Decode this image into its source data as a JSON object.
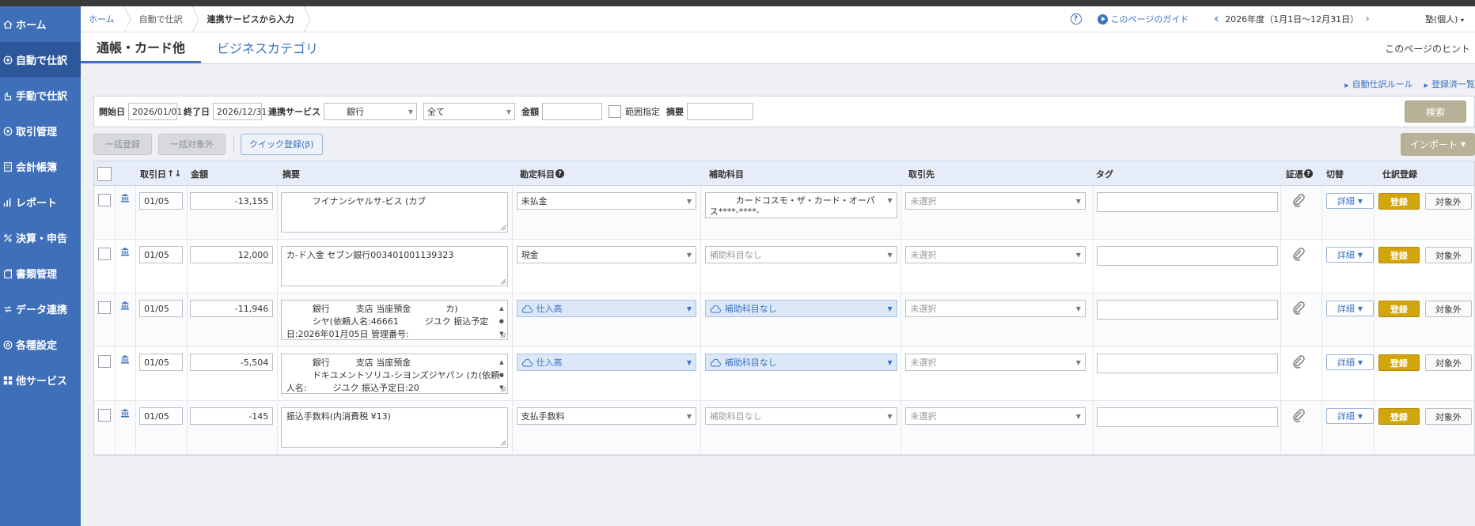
{
  "sidebar": {
    "items": [
      {
        "label": "ホーム",
        "icon": "home-icon",
        "active": false
      },
      {
        "label": "自動で仕訳",
        "icon": "auto-journal-icon",
        "active": true
      },
      {
        "label": "手動で仕訳",
        "icon": "hand-journal-icon",
        "active": false
      },
      {
        "label": "取引管理",
        "icon": "transaction-icon",
        "active": false
      },
      {
        "label": "会計帳簿",
        "icon": "ledger-icon",
        "active": false
      },
      {
        "label": "レポート",
        "icon": "report-icon",
        "active": false
      },
      {
        "label": "決算・申告",
        "icon": "tax-return-icon",
        "active": false
      },
      {
        "label": "書類管理",
        "icon": "documents-icon",
        "active": false
      },
      {
        "label": "データ連携",
        "icon": "data-link-icon",
        "active": false
      },
      {
        "label": "各種設定",
        "icon": "settings-icon",
        "active": false
      },
      {
        "label": "他サービス",
        "icon": "other-services-icon",
        "active": false
      }
    ]
  },
  "breadcrumb": {
    "home": "ホーム",
    "auto": "自動で仕訳",
    "current": "連携サービスから入力"
  },
  "header": {
    "help_q": "?",
    "guide": "このページのガイド",
    "fiscal_year": "2026年度（1月1日〜12月31日）",
    "user": "塾(個人)"
  },
  "tabs": {
    "tab1": "通帳・カード他",
    "tab2": "ビジネスカテゴリ",
    "hint": "このページのヒント"
  },
  "links": {
    "rules": "自動仕訳ルール",
    "registered": "登録済一覧"
  },
  "search": {
    "start_label": "開始日",
    "start_value": "2026/01/01",
    "end_label": "終了日",
    "end_value": "2026/12/31",
    "service_label": "連携サービス",
    "service_value": "銀行",
    "account_value": "全て",
    "amount_label": "金額",
    "range_label": "範囲指定",
    "memo_label": "摘要",
    "search_button": "検索"
  },
  "actions": {
    "bulk_register": "一括登録",
    "bulk_exclude": "一括対象外",
    "quick_register": "クイック登録(β)",
    "import": "インポート"
  },
  "table": {
    "headers": {
      "date": "取引日",
      "sort": "↑↓",
      "amount": "金額",
      "memo": "摘要",
      "account": "勘定科目",
      "sub_account": "補助科目",
      "partner": "取引先",
      "tag": "タグ",
      "evidence": "証憑",
      "toggle": "切替",
      "register": "仕訳登録"
    },
    "detail_label": "詳細",
    "register_label": "登録",
    "exclude_label": "対象外",
    "rows": [
      {
        "date": "01/05",
        "amount": "-13,155",
        "memo": "　　　フイナンシヤルサ-ビス (カブ",
        "account": "未払金",
        "account_hl": false,
        "sub": "　　　カードコスモ・ザ・カード・オーパス****-****-",
        "sub_hl": false,
        "sub_ph": false,
        "partner": "未選択"
      },
      {
        "date": "01/05",
        "amount": "12,000",
        "memo": "カ-ド入金 セブン銀行003401001139323",
        "account": "現金",
        "account_hl": false,
        "sub": "補助科目なし",
        "sub_hl": false,
        "sub_ph": true,
        "partner": "未選択"
      },
      {
        "date": "01/05",
        "amount": "-11,946",
        "memo": "　　　銀行　　　支店 当座預金　　　　カ)\n　　　シヤ(依頼人名:46661　　　ジユク 振込予定日:2026年01月05日 管理番号:",
        "account": "仕入高",
        "account_hl": true,
        "sub": "補助科目なし",
        "sub_hl": true,
        "sub_ph": false,
        "partner": "未選択"
      },
      {
        "date": "01/05",
        "amount": "-5,504",
        "memo": "　　　銀行　　　支店 当座預金\n　　　ドキユメントソリユ-シヨンズジヤパン (カ(依頼人名:　　　ジユク 振込予定日:20",
        "account": "仕入高",
        "account_hl": true,
        "sub": "補助科目なし",
        "sub_hl": true,
        "sub_ph": false,
        "partner": "未選択"
      },
      {
        "date": "01/05",
        "amount": "-145",
        "memo": "振込手数料(内消費税 ¥13)",
        "account": "支払手数料",
        "account_hl": false,
        "sub": "補助科目なし",
        "sub_hl": false,
        "sub_ph": true,
        "partner": "未選択"
      }
    ]
  },
  "colors": {
    "sidebar": "#3f6fb8",
    "sidebar_active": "#2d579b",
    "link": "#3c72c0",
    "register_button": "#d3a50c",
    "search_button": "#b7b197"
  }
}
